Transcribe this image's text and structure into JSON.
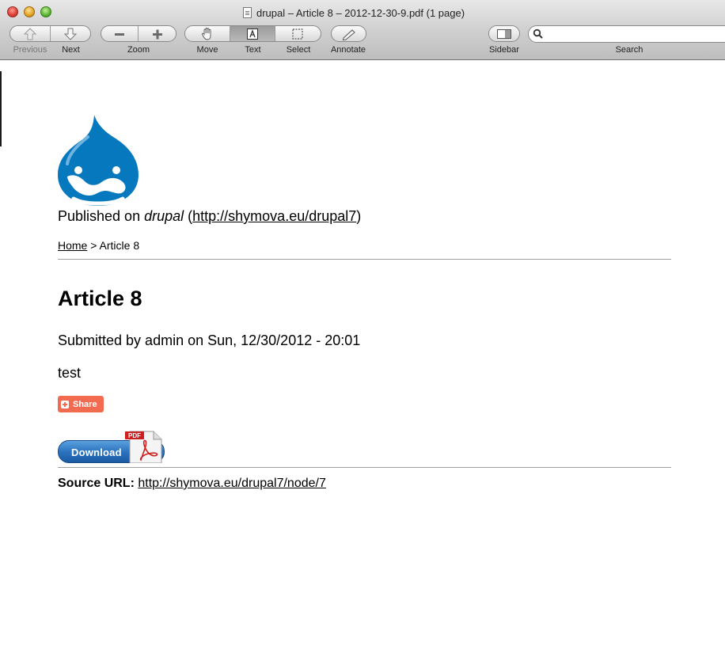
{
  "window": {
    "title": "drupal – Article 8 – 2012-12-30-9.pdf (1 page)"
  },
  "toolbar": {
    "previous_label": "Previous",
    "next_label": "Next",
    "zoom_label": "Zoom",
    "move_label": "Move",
    "text_label": "Text",
    "select_label": "Select",
    "annotate_label": "Annotate",
    "sidebar_label": "Sidebar",
    "search_label": "Search",
    "search_value": ""
  },
  "document": {
    "published_prefix": "Published on ",
    "site_name": "drupal",
    "published_open": " (",
    "site_url": "http://shymova.eu/drupal7",
    "published_close": ")",
    "breadcrumb_home": "Home",
    "breadcrumb_sep": " > ",
    "breadcrumb_current": "Article 8",
    "title": "Article 8",
    "submitted": "Submitted by admin on Sun, 12/30/2012 - 20:01",
    "body": "test",
    "share_label": "Share",
    "download_label": "Download",
    "pdf_badge": "PDF",
    "source_label": "Source URL:",
    "source_url": "http://shymova.eu/drupal7/node/7"
  },
  "colors": {
    "drupal_blue": "#0678be",
    "share_orange": "#f26b50",
    "download_blue": "#2c74c0",
    "pdf_red": "#cc1f1f"
  }
}
